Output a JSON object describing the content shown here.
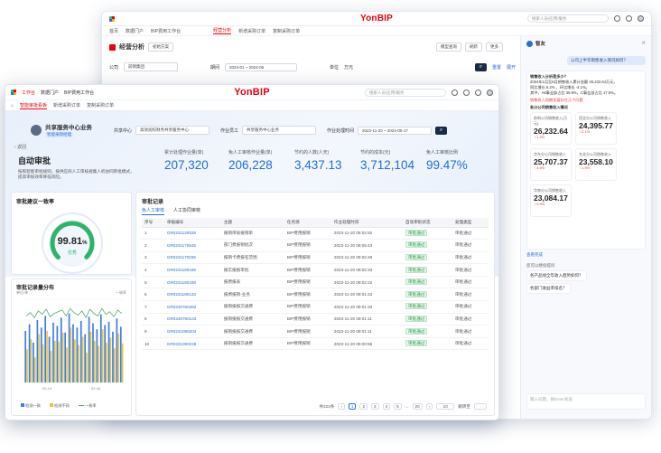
{
  "back_window": {
    "logo": "YonBIP",
    "search_placeholder": "搜索人员/应用/服务",
    "tabs": [
      "首页",
      "数据门户",
      "BIP费用工作台"
    ],
    "tab2": [
      "经营分析",
      "新增采购订单",
      "复制采购订单"
    ],
    "page_title": "经营分析",
    "plan_tag": "初始方案",
    "filters": [
      {
        "label": "公司",
        "value": "前哨集团"
      },
      {
        "label": "期间",
        "value": "2024-01 ~ 2024-06"
      },
      {
        "label": "单位",
        "value": "万元"
      }
    ],
    "buttons": [
      "模型查询",
      "刷新",
      "更多"
    ],
    "filter_links": [
      "重置",
      "展开"
    ],
    "chat": {
      "title": "智友",
      "user_question": "公司上半年销售收入情况如何？",
      "answer_lines": [
        "销售收入分析是多少？",
        "2024年1月至6月销售收入累计金额 26,232.64万元，",
        "同比增长 8.2% ，环比增长 -4.1%。",
        "其中，A6事业部占比 35.8%，C事业部占比 17.6%。"
      ],
      "alert": "销售收入同期发展存在几个问题",
      "section": "各分公司销售收入情况",
      "cards": [
        {
          "title": "前哨公司销售收入(万元)",
          "value": "26,232.64",
          "delta": "↑ 1.2%"
        },
        {
          "title": "西北分公司销售收入",
          "value": "24,395.77",
          "delta": "↑ 2.1%"
        },
        {
          "title": "华东分公司销售收入",
          "value": "25,707.37",
          "delta": "↑ 3.6%"
        },
        {
          "title": "东北分公司销售收入",
          "value": "23,558.10",
          "delta": "↑ 1.9%"
        },
        {
          "title": "华南分公司销售收入",
          "value": "23,084.17",
          "delta": "↑ 0.9%"
        }
      ],
      "more": "查看完成",
      "prompts": [
        "您可以继续提问",
        "各产品线全年收入趋势如何？",
        "各部门收益率排名？"
      ],
      "input_placeholder": "输入问题，按Enter发送"
    }
  },
  "front_window": {
    "logo": "YonBIP",
    "top_tabs": [
      "工作台",
      "数据门户",
      "BIP费用工作台"
    ],
    "search_placeholder": "搜索人员/应用/服务",
    "sub_tabs": [
      "智能审批看板",
      "新增采购订单",
      "复制采购订单"
    ],
    "profile_name": "共享服务中心业务",
    "profile_tag": "智能采购经理",
    "filters": [
      {
        "label": "共享中心",
        "value": "高效润综财务共享服务中心"
      },
      {
        "label": "作业员工",
        "value": "共享服务中心业务"
      },
      {
        "label": "作业处理时间",
        "value": "2023-11-20 ~ 2024-05-17"
      }
    ],
    "back_label": "返回",
    "banner_title": "自动审批",
    "banner_desc_1": "按照智能审批规则，按供应商人工审核规集人机协同审批模式，",
    "banner_desc_2": "提高审核效率降低风险。",
    "kpis": [
      {
        "label": "累计处理作业量(单)",
        "value": "207,320"
      },
      {
        "label": "免人工审核作业量(单)",
        "value": "206,228"
      },
      {
        "label": "节约的人数(人天)",
        "value": "3,437.13"
      },
      {
        "label": "节约的成本(元)",
        "value": "3,712,104"
      },
      {
        "label": "免人工审核比例",
        "value": "99.47%"
      }
    ],
    "gauge": {
      "title": "审批建议一致率",
      "value": "99.81",
      "unit": "%",
      "level": "优秀",
      "fraction": 0.9981
    },
    "dist": {
      "title": "审批记录量分布",
      "unit_left": "单位/单",
      "unit_right": "一致率",
      "x_ticks": [
        "02-14",
        "02-18"
      ],
      "legend": [
        "检测一致",
        "检测不同",
        "一致率"
      ]
    },
    "records": {
      "title": "审批记录",
      "tabs": [
        "免人工审核",
        "人工协同审核"
      ],
      "columns": [
        "序号",
        "单据编号",
        "主题",
        "任务源",
        "作业处理时间",
        "自动审批状态",
        "处理类型"
      ],
      "rows": [
        [
          "1",
          "GR0231120028",
          "报销审核报销单",
          "BIP费用报销",
          "2023-11-20 09:02:52",
          "审批通过",
          "审批通过"
        ],
        [
          "2",
          "GR0231170645",
          "部门费报销批次",
          "BIP费用报销",
          "2023-11-20 09:05:43",
          "审批通过",
          "审批通过"
        ],
        [
          "3",
          "GR0231170035",
          "报销卡费报名范围",
          "BIP费用报销",
          "2023-11-20 09:02:49",
          "审批通过",
          "审批通过"
        ],
        [
          "4",
          "GR0231180346",
          "报实报报审批",
          "BIP费用报销",
          "2023-11-20 09:02:33",
          "审批通过",
          "审批通过"
        ],
        [
          "5",
          "GR0231180338",
          "报费报表",
          "BIP费用报销",
          "2023-11-20 09:02:22",
          "审批通过",
          "审批通过"
        ],
        [
          "6",
          "GR0231180133",
          "报费报销-业务",
          "BIP费用报销",
          "2023-11-20 09:01:43",
          "审批通过",
          "审批通过"
        ],
        [
          "7",
          "GR0230760362",
          "报销报报交通费",
          "BIP费用报销",
          "2023-11-20 09:01:33",
          "审批通过",
          "审批通过"
        ],
        [
          "8",
          "GR0230760133",
          "报销报报交通费",
          "BIP费用报销",
          "2023-11-20 09:01:11",
          "审批通过",
          "审批通过"
        ],
        [
          "9",
          "GR0231090204",
          "报销报报交通费",
          "BIP费用报销",
          "2023-11-20 09:01:11",
          "审批通过",
          "审批通过"
        ],
        [
          "10",
          "GR0231090228",
          "报销报报交通费",
          "BIP费用报销",
          "2023-11-20 09:00:56",
          "审批通过",
          "审批通过"
        ]
      ],
      "pager": {
        "total": "共222条",
        "pages": [
          "1",
          "2",
          "3",
          "4",
          "5",
          "...",
          "20"
        ],
        "page_size": "10",
        "jump_label": "跳转至"
      }
    }
  },
  "chart_data": {
    "type": "bar",
    "title": "审批记录量分布",
    "x_ticks": [
      "02-14",
      "02-18"
    ],
    "series": [
      {
        "name": "检测一致",
        "values": [
          62,
          70,
          48,
          75,
          66,
          80,
          55,
          72,
          68,
          78,
          60,
          83,
          70,
          66,
          74,
          58,
          79,
          71,
          64,
          82,
          69,
          73,
          61,
          77,
          67
        ]
      },
      {
        "name": "检测不同",
        "values": [
          40,
          52,
          30,
          58,
          46,
          62,
          38,
          50,
          49,
          60,
          42,
          66,
          52,
          45,
          55,
          36,
          61,
          50,
          44,
          64,
          48,
          54,
          41,
          59,
          47
        ]
      },
      {
        "name": "一致率",
        "values": [
          0.8,
          0.84,
          0.78,
          0.86,
          0.82,
          0.88,
          0.79,
          0.83,
          0.85,
          0.87,
          0.8,
          0.89,
          0.84,
          0.81,
          0.86,
          0.78,
          0.88,
          0.83,
          0.8,
          0.89,
          0.82,
          0.85,
          0.79,
          0.87,
          0.83
        ]
      }
    ],
    "colors": [
      "#3d7be8",
      "#e8c53d",
      "#5aa86b"
    ]
  }
}
